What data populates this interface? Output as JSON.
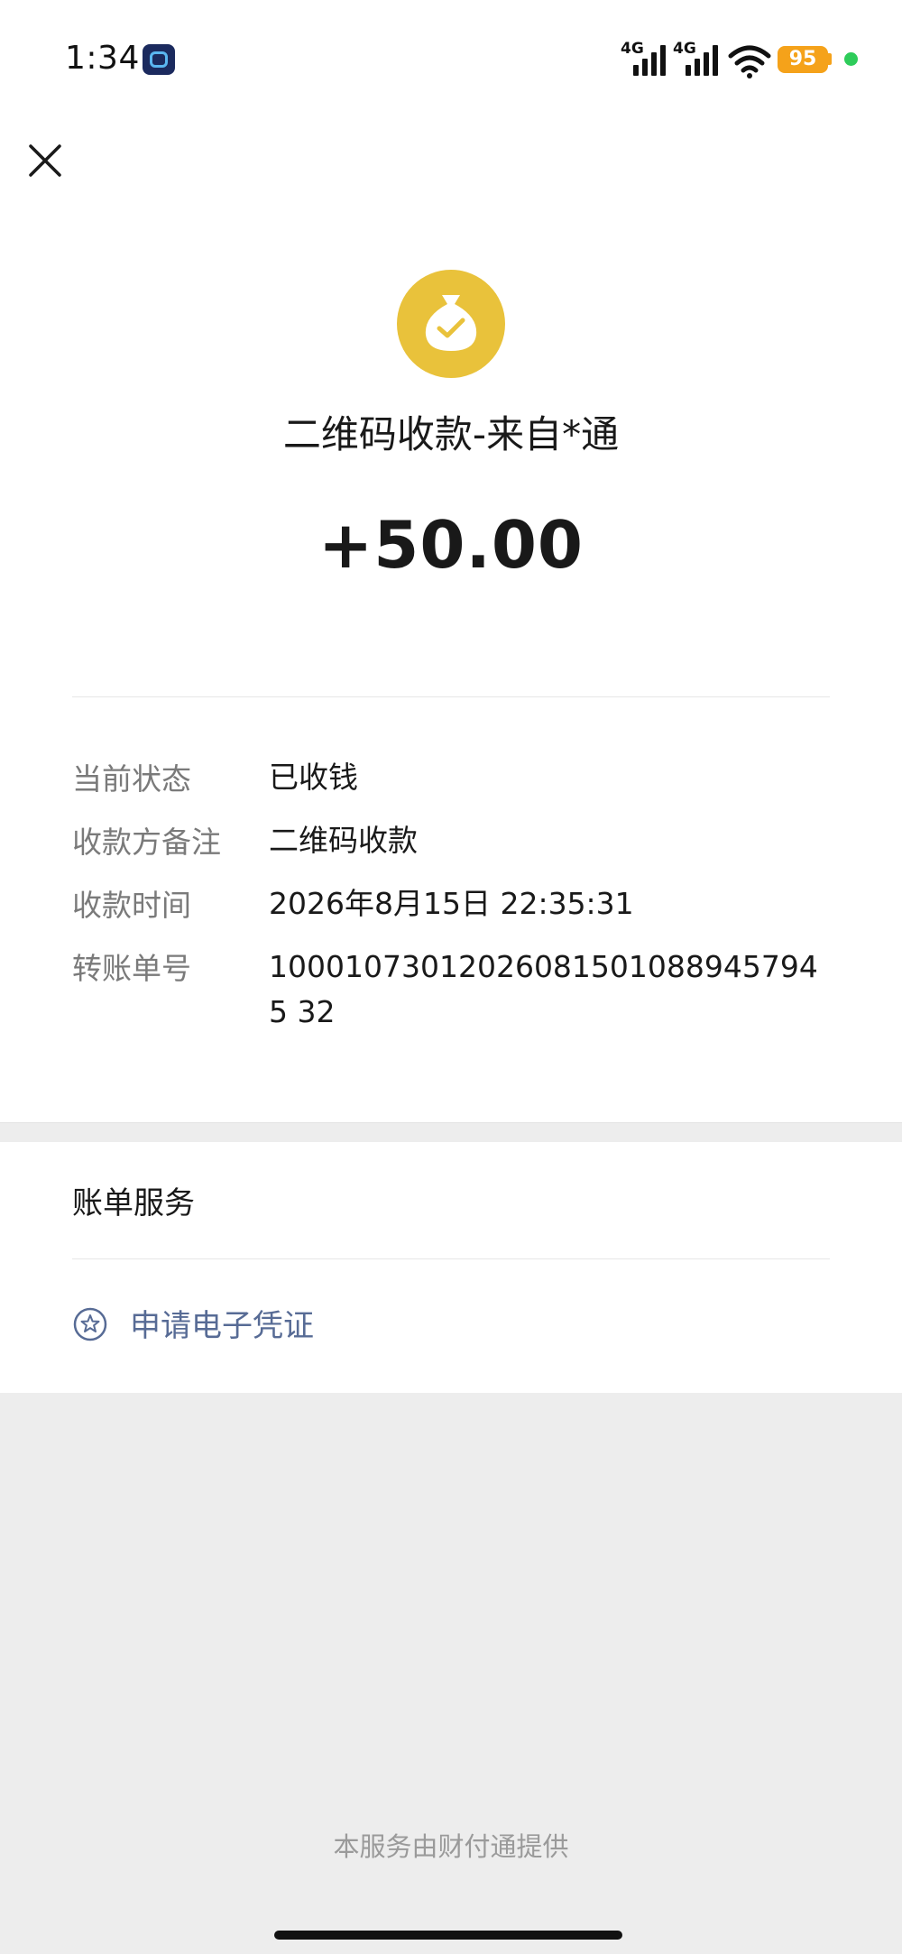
{
  "status_bar": {
    "time": "1:34",
    "signal1_label": "4G",
    "signal2_label": "4G",
    "battery_level": "95"
  },
  "header": {
    "close_icon": "close-icon"
  },
  "transaction": {
    "icon": "money-bag-check-icon",
    "icon_color": "#e9c23b",
    "title": "二维码收款-来自*通",
    "amount": "+50.00"
  },
  "details": [
    {
      "label": "当前状态",
      "value": "已收钱"
    },
    {
      "label": "收款方备注",
      "value": "二维码收款"
    },
    {
      "label": "收款时间",
      "value": "2026年8月15日 22:35:31"
    },
    {
      "label": "转账单号",
      "value": "100010730120260815010889457945 32"
    }
  ],
  "bill_service": {
    "title": "账单服务",
    "voucher_label": "申请电子凭证",
    "voucher_icon": "star-circle-icon",
    "link_color": "#576b95"
  },
  "footer": {
    "text": "本服务由财付通提供"
  }
}
